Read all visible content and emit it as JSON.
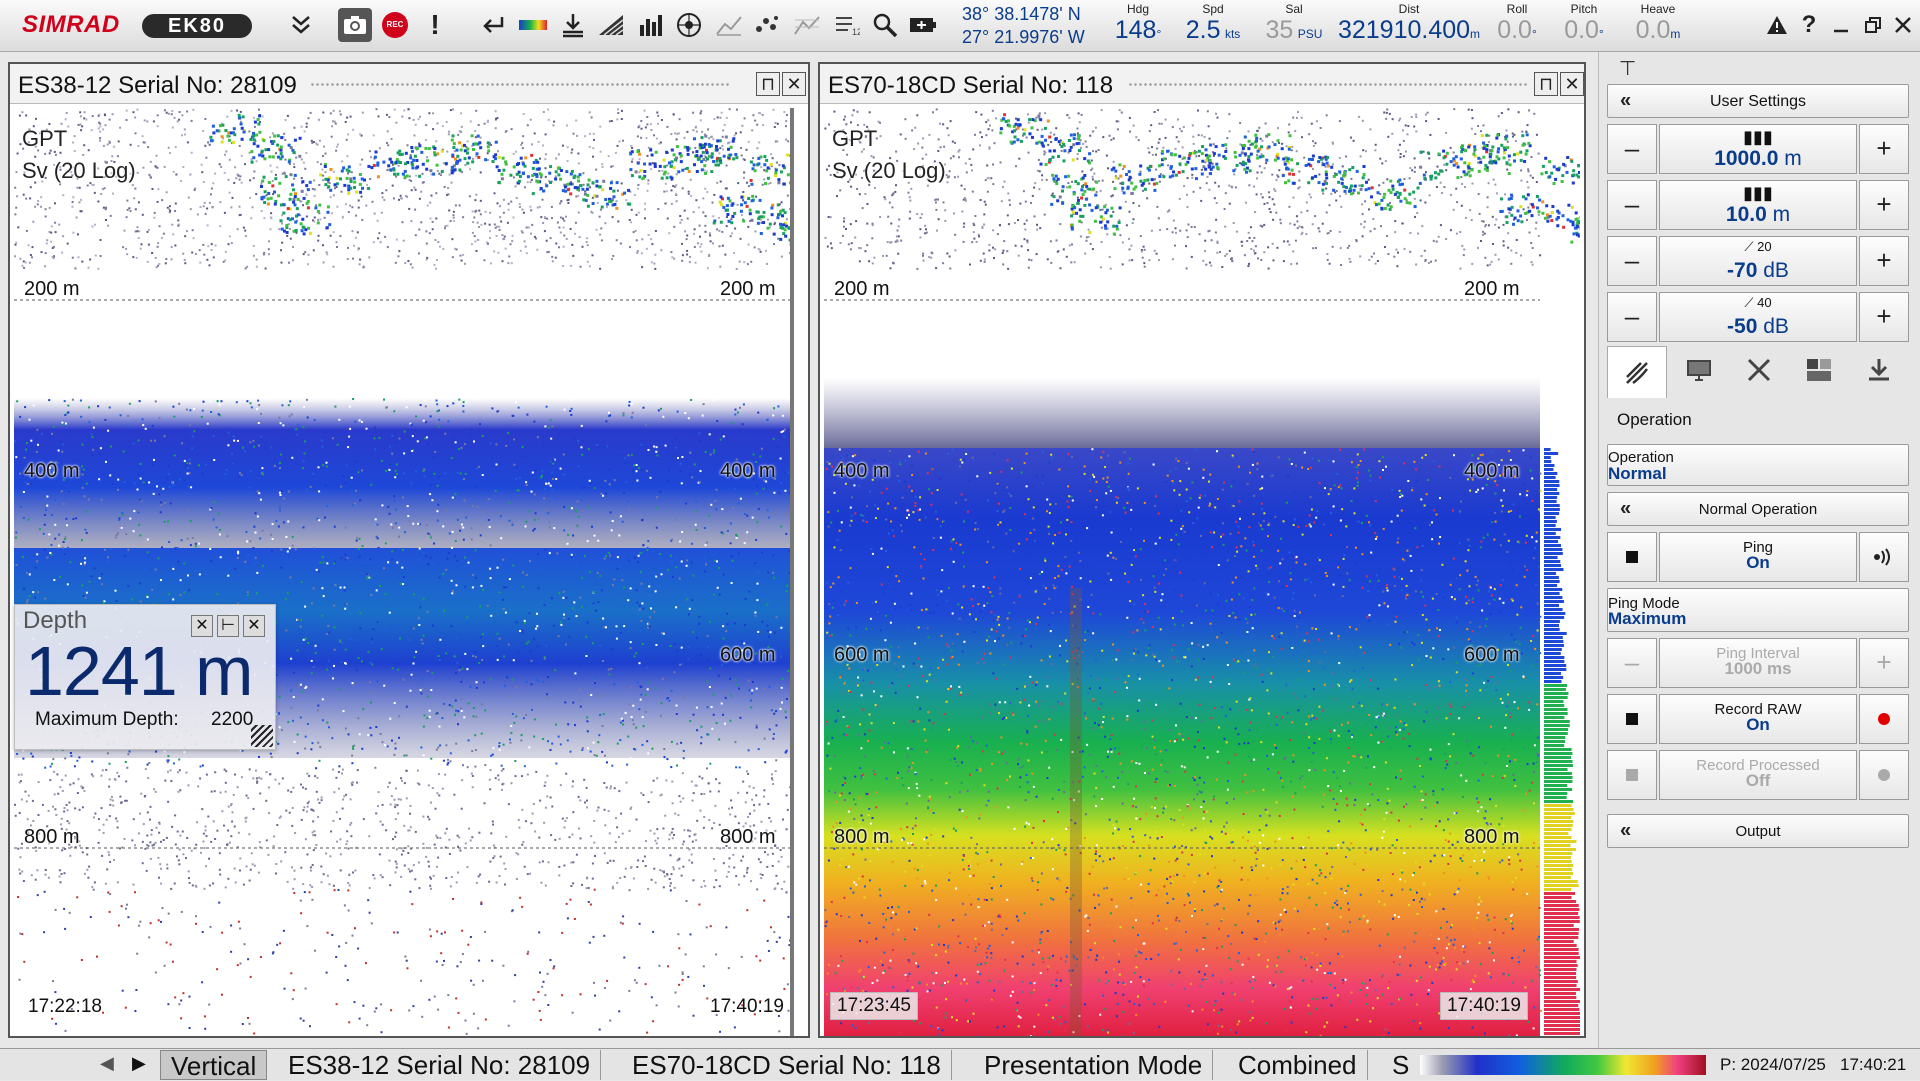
{
  "app": {
    "brand": "SIMRAD",
    "product": "EK80"
  },
  "nav": {
    "lat": "38° 38.1478' N",
    "lon": "27° 21.9976' W",
    "hdg": {
      "label": "Hdg",
      "value": "148",
      "unit": "°"
    },
    "spd": {
      "label": "Spd",
      "value": "2.5",
      "unit": "kts"
    },
    "sal": {
      "label": "Sal",
      "value": "35",
      "unit": "PSU"
    },
    "dist": {
      "label": "Dist",
      "value": "321910.400",
      "unit": "m"
    },
    "roll": {
      "label": "Roll",
      "value": "0.0",
      "unit": "°"
    },
    "pitch": {
      "label": "Pitch",
      "value": "0.0",
      "unit": "°"
    },
    "heave": {
      "label": "Heave",
      "value": "0.0",
      "unit": "m"
    }
  },
  "toolbar": {
    "icons": [
      "expand-chevrons-icon",
      "camera-icon",
      "record-icon",
      "alert-icon",
      "return-icon",
      "color-scale-icon",
      "download-icon",
      "hatch-icon",
      "bar-chart-icon",
      "target-icon",
      "line-chart-icon",
      "scatter-icon",
      "grid-chart-icon",
      "list-icon",
      "zoom-icon",
      "battery-icon",
      "warning-icon",
      "help-icon",
      "minimize-icon",
      "restore-icon",
      "close-icon"
    ],
    "rec_label": "REC",
    "help_label": "?",
    "alert_label": "!"
  },
  "panels": {
    "left": {
      "title": "ES38-12 Serial No: 28109",
      "label1": "GPT",
      "label2": "Sv (20 Log)",
      "depth_ticks": [
        "200 m",
        "400 m",
        "600 m",
        "800 m"
      ],
      "time_start": "17:22:18",
      "time_end": "17:40:19"
    },
    "right": {
      "title": "ES70-18CD Serial No: 118",
      "label1": "GPT",
      "label2": "Sv (20 Log)",
      "depth_ticks": [
        "200 m",
        "400 m",
        "600 m",
        "800 m"
      ],
      "time_start": "17:23:45",
      "time_end": "17:40:19"
    }
  },
  "depth_window": {
    "title": "Depth",
    "value": "1241 m",
    "max_label": "Maximum Depth:",
    "max_value": "2200"
  },
  "right_panel": {
    "user_settings": "User Settings",
    "range": "1000.0",
    "range_unit": "m",
    "range_start": "10.0",
    "range_start_unit": "m",
    "gain1_top": "20",
    "gain1": "-70",
    "gain1_unit": "dB",
    "gain2_top": "40",
    "gain2": "-50",
    "gain2_unit": "dB",
    "minus": "–",
    "plus": "+",
    "section": "Operation",
    "operation": {
      "label": "Operation",
      "value": "Normal"
    },
    "normal_operation": "Normal Operation",
    "ping": {
      "label": "Ping",
      "value": "On"
    },
    "ping_mode": {
      "label": "Ping Mode",
      "value": "Maximum"
    },
    "ping_interval": {
      "label": "Ping Interval",
      "value": "1000 ms"
    },
    "record_raw": {
      "label": "Record RAW",
      "value": "On"
    },
    "record_processed": {
      "label": "Record Processed",
      "value": "Off"
    },
    "output": "Output",
    "tabs": [
      "echogram-tab-icon",
      "display-tab-icon",
      "setup-tab-icon",
      "windows-tab-icon",
      "install-tab-icon"
    ]
  },
  "bottom": {
    "tabs": [
      "Vertical",
      "ES38-12 Serial No: 28109",
      "ES70-18CD Serial No: 118",
      "Presentation Mode",
      "Combined",
      "S"
    ],
    "active_tab": "Vertical",
    "date": "P: 2024/07/25",
    "time": "17:40:21"
  },
  "colors": {
    "brand_red": "#d0021b",
    "value_blue": "#0a3c8c",
    "record_dot": "#e00000"
  }
}
